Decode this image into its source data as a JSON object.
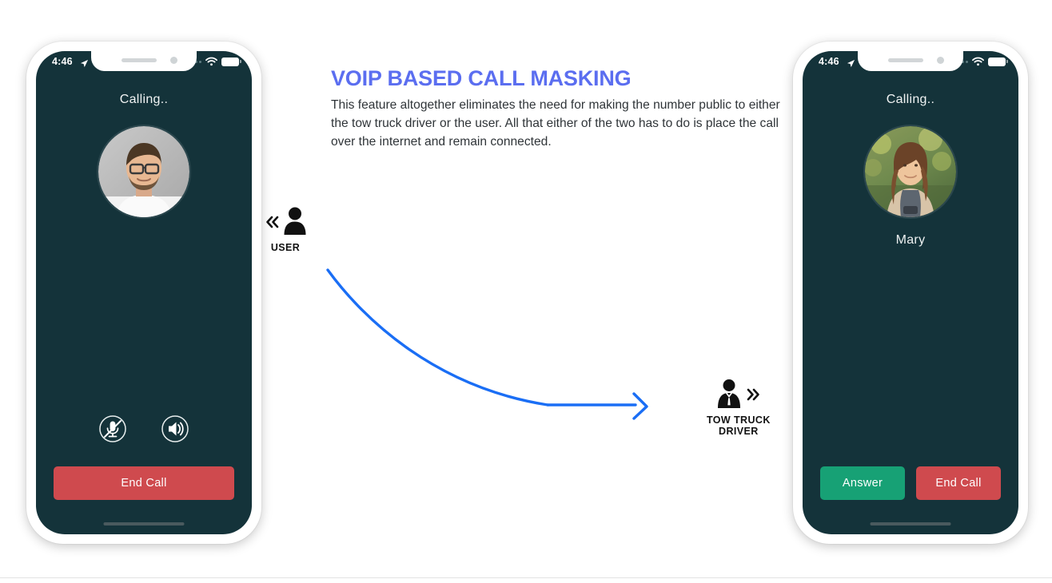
{
  "info": {
    "title": "VOIP BASED CALL MASKING",
    "body": "This feature altogether eliminates the need for making the number public to either the tow truck driver or the user. All that either of the two has to do is place the call over the internet and remain connected."
  },
  "colors": {
    "heading": "#5b6ef0",
    "arrow": "#1a6ef5",
    "screen_bg": "#14333a",
    "end_call": "#cf4a4e",
    "answer": "#17a175",
    "frame": "#ffffff"
  },
  "phone_left": {
    "status_bar": {
      "time": "4:46",
      "location_icon": "location-arrow-icon",
      "signal_icon": "signal-dots-icon",
      "wifi_icon": "wifi-icon",
      "battery_icon": "battery-full-icon"
    },
    "call_status": "Calling..",
    "avatar_alt": "man-with-glasses-avatar",
    "contact_name": "",
    "controls": [
      {
        "name": "mute-microphone-icon",
        "label": "Mute"
      },
      {
        "name": "speaker-icon",
        "label": "Speaker"
      }
    ],
    "buttons": [
      {
        "name": "end-call-button",
        "label": "End Call",
        "style": "end"
      }
    ]
  },
  "phone_right": {
    "status_bar": {
      "time": "4:46",
      "location_icon": "location-arrow-icon",
      "signal_icon": "signal-dots-icon",
      "wifi_icon": "wifi-icon",
      "battery_icon": "battery-full-icon"
    },
    "call_status": "Calling..",
    "avatar_alt": "woman-outdoors-avatar",
    "contact_name": "Mary",
    "buttons": [
      {
        "name": "answer-button",
        "label": "Answer",
        "style": "answer"
      },
      {
        "name": "end-call-button",
        "label": "End Call",
        "style": "end"
      }
    ]
  },
  "actors": {
    "user": {
      "label": "USER",
      "icon": "person-icon",
      "chevron": "chevron-double-left-icon"
    },
    "driver": {
      "label": "TOW TRUCK\nDRIVER",
      "icon": "businessman-icon",
      "chevron": "chevron-double-right-icon"
    }
  },
  "flow": {
    "arrow_name": "call-flow-arrow",
    "direction": "user-to-driver"
  }
}
